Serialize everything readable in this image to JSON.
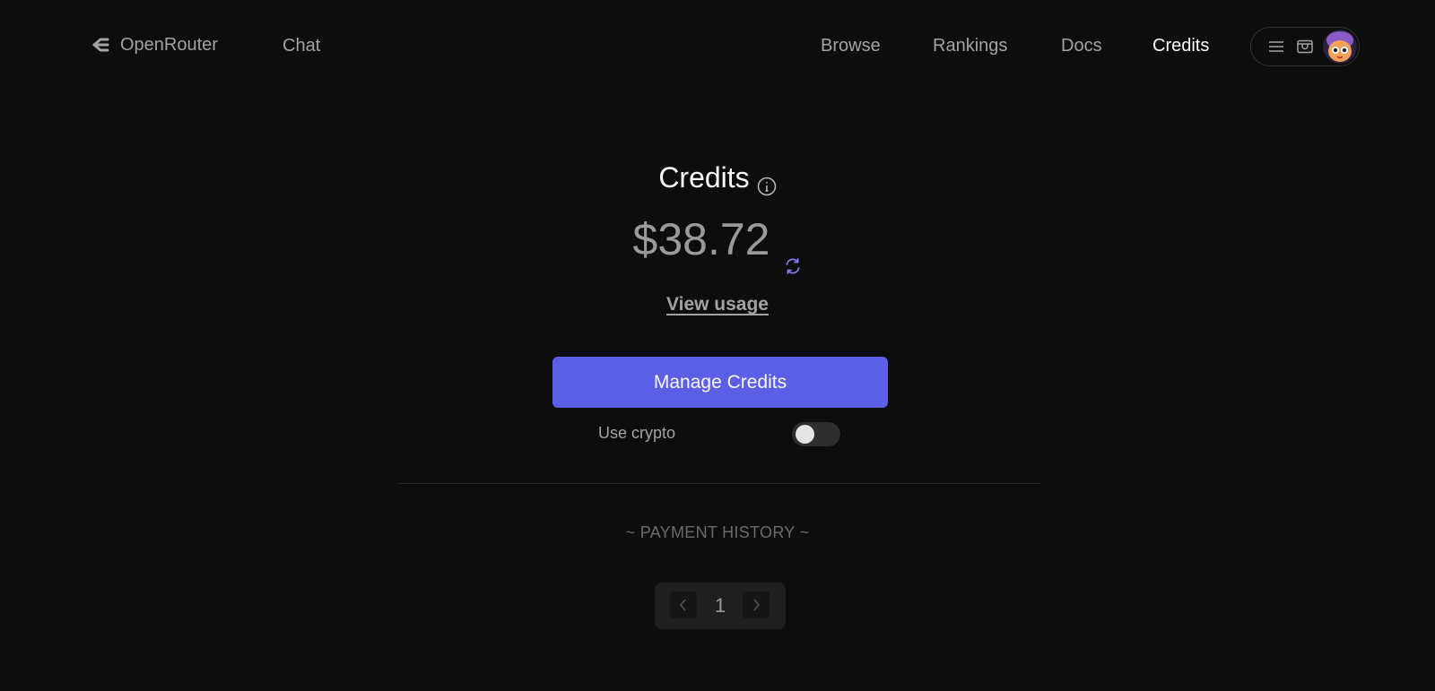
{
  "nav": {
    "brand": "OpenRouter",
    "chat": "Chat",
    "links": [
      "Browse",
      "Rankings",
      "Docs",
      "Credits"
    ],
    "active": "Credits",
    "icons": [
      "menu-icon",
      "wallet-icon",
      "avatar"
    ]
  },
  "credits": {
    "title": "Credits",
    "balance": "$38.72",
    "view_usage": "View usage",
    "manage_button": "Manage Credits",
    "use_crypto_label": "Use crypto",
    "use_crypto_enabled": false
  },
  "payment_history": {
    "heading": "~ PAYMENT HISTORY ~",
    "page": "1"
  },
  "colors": {
    "accent": "#5b5fe6",
    "background": "#0d0d0d",
    "refresh_icon": "#7b7ff0"
  }
}
